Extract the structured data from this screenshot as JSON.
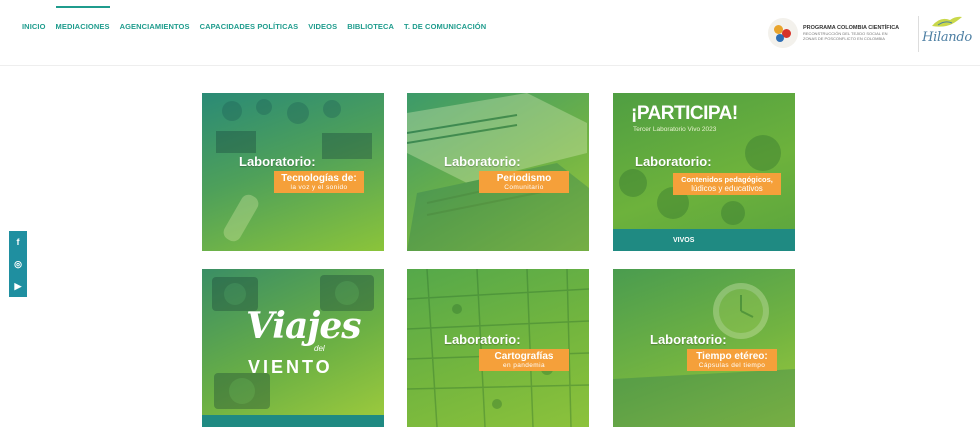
{
  "nav": [
    "INICIO",
    "MEDIACIONES",
    "AGENCIAMIENTOS",
    "CAPACIDADES POLÍTICAS",
    "VIDEOS",
    "BIBLIOTECA",
    "T. DE COMUNICACIÓN"
  ],
  "active_nav": "MEDIACIONES",
  "partner_logo": {
    "title": "PROGRAMA COLOMBIA CIENTÍFICA",
    "line1": "RECONSTRUCCIÓN DEL TEJIDO SOCIAL EN",
    "line2": "ZONAS DE POSCONFLICTO EN COLOMBIA"
  },
  "brand_logo": "Hilando",
  "social": [
    {
      "icon": "facebook-icon",
      "glyph": "f"
    },
    {
      "icon": "instagram-icon",
      "glyph": "◎"
    },
    {
      "icon": "youtube-icon",
      "glyph": "▶"
    }
  ],
  "colors": {
    "accent": "#1f9c8d",
    "green": "#7fb93a",
    "teal": "#1f8a82",
    "orange": "#f5a03a"
  },
  "cards": [
    {
      "label": "Laboratorio:",
      "title": "Tecnologías de:",
      "subtitle": "la voz y el sonido"
    },
    {
      "label": "Laboratorio:",
      "title": "Periodismo",
      "subtitle": "Comunitario"
    },
    {
      "label": "Laboratorio:",
      "title": "Contenidos pedagógicos,",
      "subtitle": "lúdicos y educativos",
      "header": "¡PARTICIPA!",
      "header_sub": "Tercer Laboratorio Vivo 2023",
      "footer": "VIVOS"
    },
    {
      "title": "Viajes",
      "small": "del",
      "subtitle": "VIENTO"
    },
    {
      "label": "Laboratorio:",
      "title": "Cartografías",
      "subtitle": "en pandemia"
    },
    {
      "label": "Laboratorio:",
      "title": "Tiempo etéreo:",
      "subtitle": "Cápsulas del tiempo"
    }
  ]
}
